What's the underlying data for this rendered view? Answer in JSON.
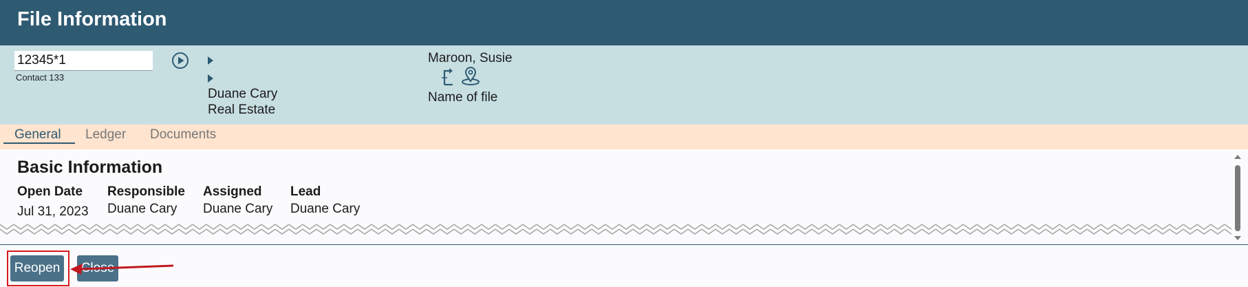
{
  "window": {
    "title": "File Information"
  },
  "header": {
    "file_number": "12345*1",
    "contact": "Contact 133",
    "party_name": "Duane Cary",
    "party_type": "Real Estate",
    "client_name": "Maroon, Susie",
    "file_name": "Name of file",
    "icons": [
      "play-icon",
      "expand-triangle-icon",
      "transfer-icon",
      "location-pin-icon"
    ]
  },
  "tabs": [
    {
      "label": "General",
      "active": true
    },
    {
      "label": "Ledger",
      "active": false
    },
    {
      "label": "Documents",
      "active": false
    }
  ],
  "basic_info": {
    "title": "Basic Information",
    "columns": [
      {
        "label": "Open Date",
        "value": "Jul 31, 2023"
      },
      {
        "label": "Responsible",
        "value": "Duane Cary"
      },
      {
        "label": "Assigned",
        "value": "Duane Cary"
      },
      {
        "label": "Lead",
        "value": "Duane Cary"
      }
    ]
  },
  "actions": {
    "reopen_label": "Reopen",
    "close_label": "Close"
  },
  "colors": {
    "titlebar": "#2e5a72",
    "header_bg": "#c8dfe2",
    "tabbar_bg": "#ffe4cf",
    "button": "#4a7188",
    "highlight": "#d71920"
  }
}
